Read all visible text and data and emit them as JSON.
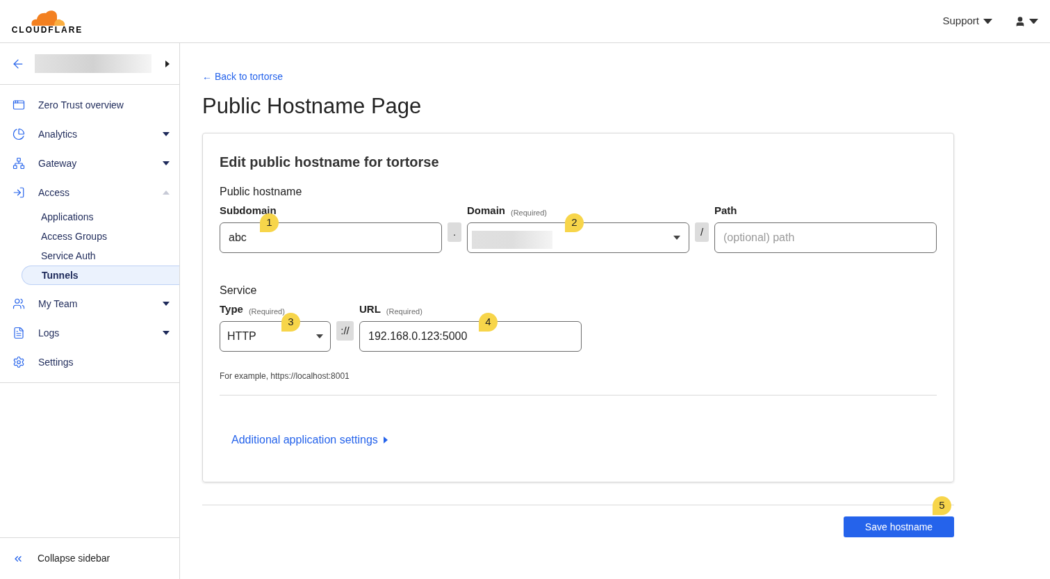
{
  "header": {
    "logo_text": "CLOUDFLARE",
    "support": "Support"
  },
  "sidebar": {
    "nav": [
      {
        "label": "Zero Trust overview",
        "kind": "link"
      },
      {
        "label": "Analytics",
        "kind": "group",
        "expanded": false
      },
      {
        "label": "Gateway",
        "kind": "group",
        "expanded": false
      },
      {
        "label": "Access",
        "kind": "group",
        "expanded": true,
        "children": [
          {
            "label": "Applications",
            "selected": false
          },
          {
            "label": "Access Groups",
            "selected": false
          },
          {
            "label": "Service Auth",
            "selected": false
          },
          {
            "label": "Tunnels",
            "selected": true
          }
        ]
      },
      {
        "label": "My Team",
        "kind": "group",
        "expanded": false
      },
      {
        "label": "Logs",
        "kind": "group",
        "expanded": false
      },
      {
        "label": "Settings",
        "kind": "link"
      }
    ],
    "collapse": "Collapse sidebar"
  },
  "main": {
    "back_link": "← Back to tortorse",
    "title": "Public Hostname Page",
    "card": {
      "title": "Edit public hostname for tortorse",
      "hostname": {
        "heading": "Public hostname",
        "subdomain": {
          "label": "Subdomain",
          "value": "abc",
          "callout": "1"
        },
        "separator_1": ".",
        "domain": {
          "label": "Domain",
          "required": "(Required)",
          "callout": "2"
        },
        "separator_2": "/",
        "path": {
          "label": "Path",
          "placeholder": "(optional) path"
        }
      },
      "service": {
        "heading": "Service",
        "type": {
          "label": "Type",
          "required": "(Required)",
          "value": "HTTP",
          "callout": "3"
        },
        "separator": "://",
        "url": {
          "label": "URL",
          "required": "(Required)",
          "value": "192.168.0.123:5000",
          "callout": "4"
        },
        "hint": "For example, https://localhost:8001"
      },
      "additional": "Additional application settings"
    },
    "save": {
      "label": "Save hostname",
      "callout": "5"
    }
  }
}
